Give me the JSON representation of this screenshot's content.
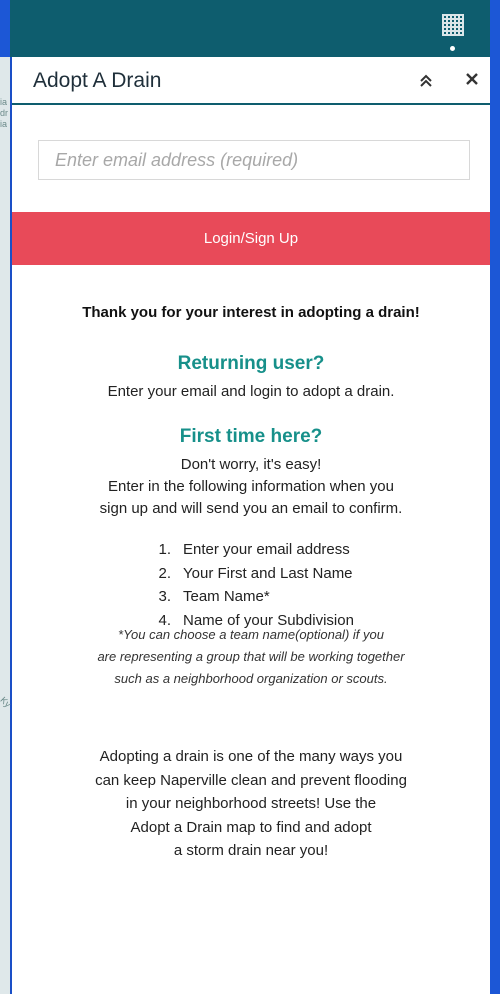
{
  "map_labels": [
    "ia",
    "dr",
    "ia",
    "Ky"
  ],
  "panel": {
    "title": "Adopt A Drain",
    "collapse_icon": "double-chevron-up-icon",
    "close_icon": "close-icon",
    "close_glyph": "×",
    "collapse_glyph": "⌃"
  },
  "form": {
    "email_placeholder": "Enter email address (required)",
    "email_value": "",
    "login_label": "Login/Sign Up"
  },
  "intro": {
    "thanks": "Thank you for your interest in adopting a drain!",
    "returning_heading": "Returning user?",
    "returning_text": "Enter your email and login to adopt a drain.",
    "first_heading": "First time here?",
    "first_line1": "Don't worry, it's easy!",
    "first_line2": "Enter in the following information when you",
    "first_line3": "sign up and will send you an email to confirm."
  },
  "steps": [
    {
      "num": "1.",
      "text": "Enter your email address"
    },
    {
      "num": "2.",
      "text": "Your First and Last Name"
    },
    {
      "num": "3.",
      "text": "Team Name*"
    },
    {
      "num": "4.",
      "text": "Name of your Subdivision"
    }
  ],
  "note": {
    "line1": "*You can choose a team name(optional) if you",
    "line2": "are representing a group that will be working together",
    "line3": "such as a neighborhood organization or scouts."
  },
  "closing": {
    "line1": "Adopting a drain is one of the many ways you",
    "line2": "can keep Naperville clean and prevent flooding",
    "line3": "in your neighborhood streets! Use the",
    "line4": "Adopt a Drain map to find and adopt",
    "line5": "a storm drain near you!"
  },
  "colors": {
    "topbar": "#0e5d6e",
    "accent_button": "#e84a59",
    "heading_teal": "#17908a",
    "frame_blue": "#1c57d6"
  }
}
